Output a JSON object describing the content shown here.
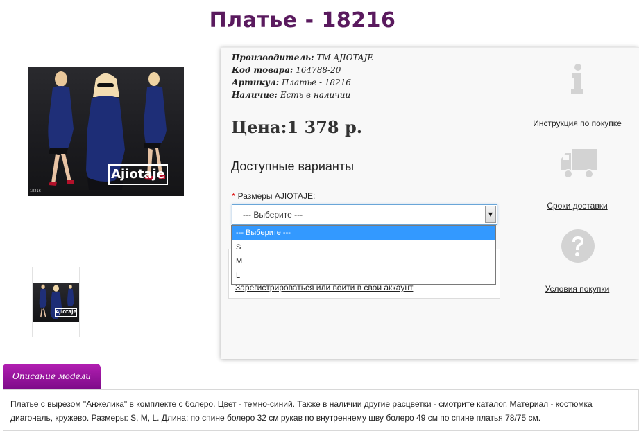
{
  "product": {
    "title": "Платье - 18216",
    "brand_logo": "Ajiotaje",
    "image_code": "18216",
    "specs": {
      "manufacturer_label": "Производитель:",
      "manufacturer_value": "ТМ AJIOTAJE",
      "code_label": "Код товара:",
      "code_value": "164788-20",
      "article_label": "Артикул:",
      "article_value": "Платье - 18216",
      "availability_label": "Наличие:",
      "availability_value": "Есть в наличии"
    },
    "price": "Цена:1 378 р.",
    "variants_title": "Доступные варианты",
    "size_label": "Размеры AJIOTAJE:",
    "size_required_mark": "*",
    "size_select": {
      "value": "--- Выберите ---",
      "options": [
        "--- Выберите ---",
        "S",
        "M",
        "L"
      ]
    },
    "register_link": "Зарегистрироваться или войти в свой аккаунт"
  },
  "sidebar": {
    "items": [
      {
        "label": "Инструкция по покупке",
        "icon": "info-icon"
      },
      {
        "label": "Сроки доставки",
        "icon": "truck-icon"
      },
      {
        "label": "Условия покупки",
        "icon": "question-icon"
      }
    ],
    "icon_color": "#d3d3d3"
  },
  "description": {
    "tab_label": "Описание модели",
    "text": "Платье с вырезом \"Анжелика\" в комплекте с болеро. Цвет - темно-синий. Также в наличии другие расцветки - смотрите каталог. Материал - костюмка диагональ, кружево. Размеры: S, M, L. Длина: по спине болеро 32 см рукав по внутреннему шву болеро 49 см по спине платья 78/75 см."
  },
  "colors": {
    "title": "#5a1a5e",
    "tab": "#9b179e",
    "selected_option": "#3399ff"
  }
}
